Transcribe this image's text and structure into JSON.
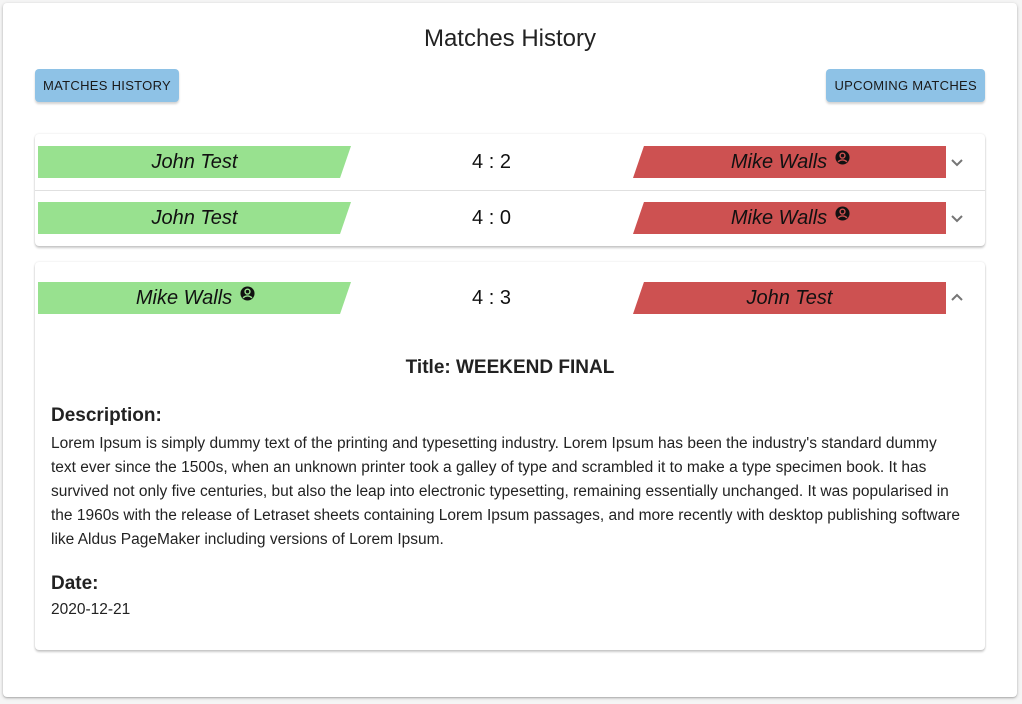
{
  "page_title": "Matches History",
  "nav": {
    "history_label": "MATCHES HISTORY",
    "upcoming_label": "UPCOMING MATCHES"
  },
  "colors": {
    "winner": "#98e18f",
    "loser": "#cd5151",
    "button": "#8ec2e6"
  },
  "icons": {
    "player_icon": "user-circle-icon",
    "expand_icon": "chevron-down-icon",
    "collapse_icon": "chevron-up-icon"
  },
  "matches": [
    {
      "left_player": "John Test",
      "left_has_icon": false,
      "score": "4 : 2",
      "right_player": "Mike Walls",
      "right_has_icon": true,
      "expanded": false
    },
    {
      "left_player": "John Test",
      "left_has_icon": false,
      "score": "4 : 0",
      "right_player": "Mike Walls",
      "right_has_icon": true,
      "expanded": false
    },
    {
      "left_player": "Mike Walls",
      "left_has_icon": true,
      "score": "4 : 3",
      "right_player": "John Test",
      "right_has_icon": false,
      "expanded": true
    }
  ],
  "details": {
    "title": "Title: WEEKEND FINAL",
    "description_label": "Description:",
    "description": "Lorem Ipsum is simply dummy text of the printing and typesetting industry. Lorem Ipsum has been the industry's standard dummy text ever since the 1500s, when an unknown printer took a galley of type and scrambled it to make a type specimen book. It has survived not only five centuries, but also the leap into electronic typesetting, remaining essentially unchanged. It was popularised in the 1960s with the release of Letraset sheets containing Lorem Ipsum passages, and more recently with desktop publishing software like Aldus PageMaker including versions of Lorem Ipsum.",
    "date_label": "Date:",
    "date": "2020-12-21"
  }
}
